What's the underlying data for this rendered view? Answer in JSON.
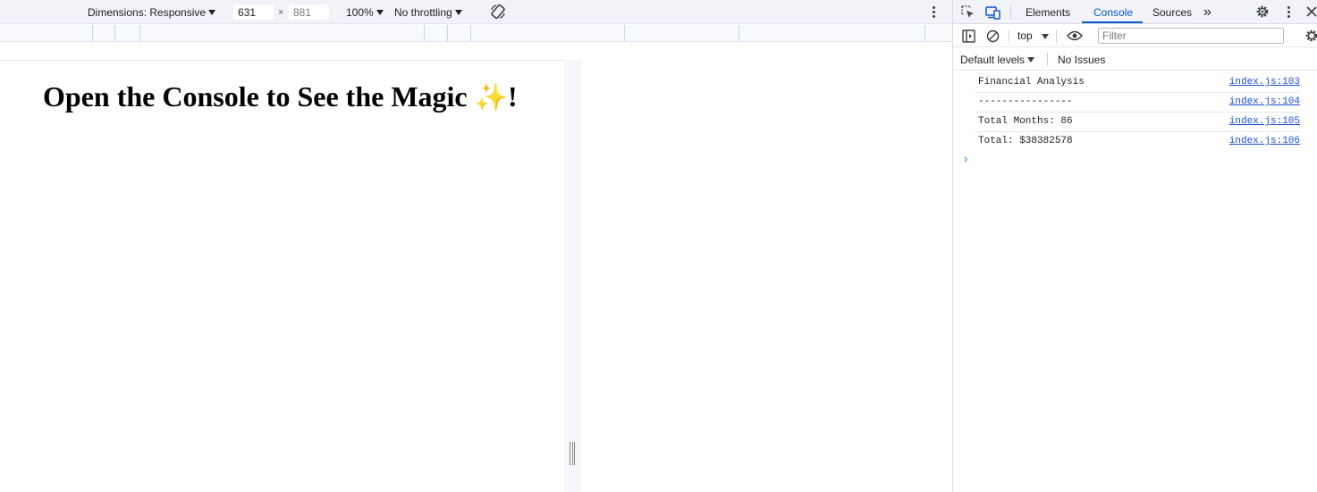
{
  "device_toolbar": {
    "dimensions_label": "Dimensions: Responsive",
    "width": "631",
    "times": "×",
    "height": "881",
    "zoom": "100%",
    "throttling": "No throttling"
  },
  "page": {
    "heading_text": "Open the Console to See the Magic ",
    "heading_sparkle": "✨",
    "heading_end": "!"
  },
  "devtools": {
    "tabs": [
      "Elements",
      "Console",
      "Sources"
    ],
    "more_tabs": "»",
    "context": "top",
    "filter_placeholder": "Filter",
    "levels": "Default levels",
    "issues": "No Issues",
    "messages": [
      {
        "text": "Financial Analysis",
        "source": "index.js:103"
      },
      {
        "text": "----------------",
        "source": "index.js:104"
      },
      {
        "text": "Total Months: 86",
        "source": "index.js:105"
      },
      {
        "text": "Total: $38382578",
        "source": "index.js:106"
      }
    ],
    "prompt": "›"
  },
  "colors": {
    "accent": "#0b57d0",
    "link": "#1a4fd0",
    "toolbar_bg": "#f1f3f8"
  }
}
